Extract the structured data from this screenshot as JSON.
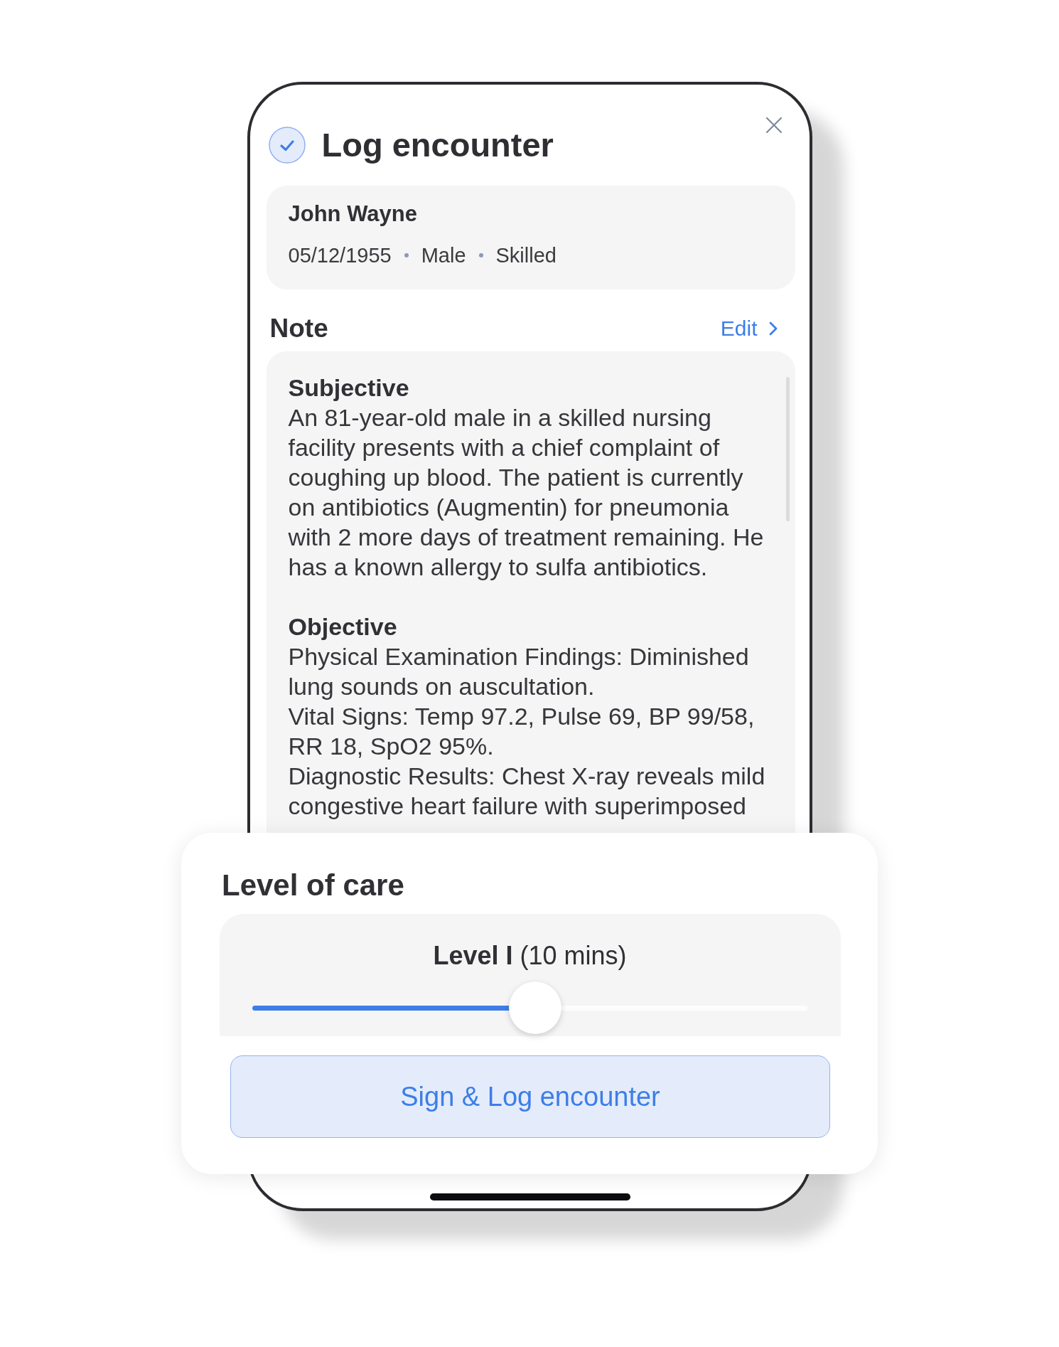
{
  "dialog": {
    "title": "Log encounter"
  },
  "patient": {
    "name": "John Wayne",
    "details": [
      "05/12/1955",
      "Male",
      "Skilled"
    ]
  },
  "note": {
    "heading": "Note",
    "edit_link": "Edit",
    "sections": [
      {
        "heading": "Subjective",
        "paragraphs": [
          "An 81-year-old male in a skilled nursing facility presents with a chief complaint of coughing up blood. The patient is currently on antibiotics (Augmentin) for pneumonia with 2 more days of treatment remaining. He has a known allergy to sulfa antibiotics."
        ]
      },
      {
        "heading": "Objective",
        "paragraphs": [
          "Physical Examination Findings: Diminished lung sounds on auscultation.",
          "Vital Signs: Temp 97.2, Pulse 69, BP 99/58, RR 18, SpO2 95%.",
          "Diagnostic Results: Chest X-ray reveals mild congestive heart failure with superimposed"
        ]
      }
    ]
  },
  "level_of_care": {
    "title": "Level of care",
    "reading": "**Level I** (10 mins)",
    "level": 0.51
  },
  "primary_button": {
    "label": "Sign & Log encounter"
  }
}
